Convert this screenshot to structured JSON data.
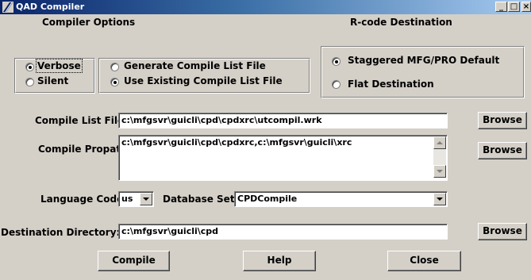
{
  "window": {
    "title": "QAD Compiler",
    "minimize": "_",
    "maximize": "□",
    "close": "×"
  },
  "compiler_options": {
    "heading": "Compiler Options",
    "verbose": "Verbose",
    "silent": "Silent",
    "mode_selected": "Verbose",
    "generate_list": "Generate Compile List File",
    "use_existing_list": "Use Existing Compile List File",
    "list_selected": "Use Existing Compile List File"
  },
  "rcode_destination": {
    "heading": "R-code Destination",
    "staggered": "Staggered MFG/PRO Default",
    "flat": "Flat Destination",
    "selected": "Staggered MFG/PRO Default"
  },
  "compile_list_file": {
    "label": "Compile List File:",
    "value": "c:\\mfgsvr\\guicli\\cpd\\cpdxrc\\utcompil.wrk",
    "browse": "Browse"
  },
  "compile_propath": {
    "label": "Compile Propath:",
    "value": "c:\\mfgsvr\\guicli\\cpd\\cpdxrc,c:\\mfgsvr\\guicli\\xrc",
    "browse": "Browse"
  },
  "language_code": {
    "label": "Language Code:",
    "value": "us"
  },
  "database_set": {
    "label": "Database Set:",
    "value": "CPDCompile"
  },
  "destination_directory": {
    "label": "Destination Directory:",
    "value": "c:\\mfgsvr\\guicli\\cpd",
    "browse": "Browse"
  },
  "actions": {
    "compile": "Compile",
    "help": "Help",
    "close": "Close"
  }
}
